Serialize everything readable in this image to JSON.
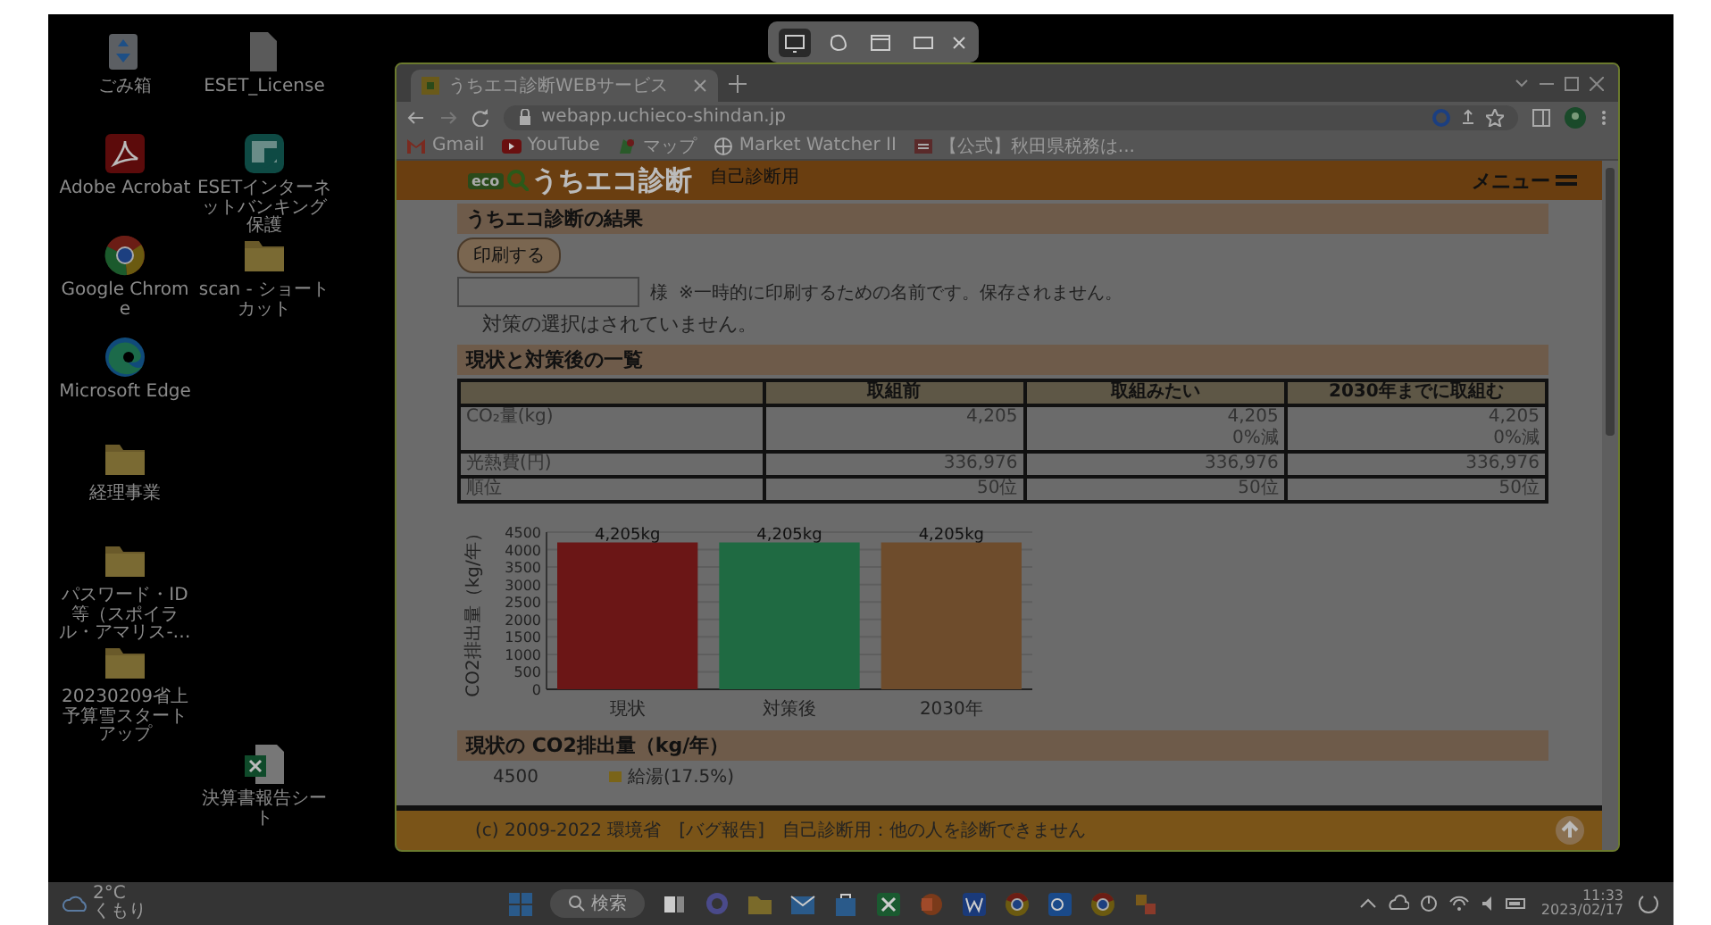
{
  "snip_toolbar": {
    "modes": [
      {
        "kind": "rectangle",
        "selected": true
      },
      {
        "kind": "freeform",
        "selected": false
      },
      {
        "kind": "window",
        "selected": false
      },
      {
        "kind": "fullscreen",
        "selected": false
      }
    ]
  },
  "desktop": {
    "icons": [
      {
        "label": "ごみ箱",
        "kind": "recycle"
      },
      {
        "label": "Adobe Acrobat",
        "kind": "pdf"
      },
      {
        "label": "Google Chrome",
        "kind": "chrome"
      },
      {
        "label": "Microsoft Edge",
        "kind": "edge"
      },
      {
        "label": "経理事業",
        "kind": "folder"
      },
      {
        "label": "パスワード・ID等（スポイラル・アマリス-…",
        "kind": "folder"
      },
      {
        "label": "20230209省上予算雪スタートアップ",
        "kind": "folder"
      },
      {
        "label": "ESET_License",
        "kind": "file"
      },
      {
        "label": "ESETインターネットバンキング保護",
        "kind": "shield"
      },
      {
        "label": "scan - ショートカット",
        "kind": "folder"
      },
      {
        "label": "決算書報告シート",
        "kind": "excel"
      }
    ]
  },
  "browser": {
    "tab": {
      "title": "うちエコ診断WEBサービス"
    },
    "address": "webapp.uchieco-shindan.jp",
    "bookmarks": [
      {
        "label": "Gmail",
        "kind": "gmail"
      },
      {
        "label": "YouTube",
        "kind": "youtube"
      },
      {
        "label": "マップ",
        "kind": "maps"
      },
      {
        "label": "Market Watcher II",
        "kind": "globe"
      },
      {
        "label": "【公式】秋田県税務は...",
        "kind": "site"
      }
    ],
    "page": {
      "header": {
        "logo_badge": "eco",
        "logo_text": "うちエコ診断",
        "mode": "自己診断用",
        "menu": "メニュー"
      },
      "result_title": "うちエコ診断の結果",
      "print_button": "印刷する",
      "name_field": {
        "suffix": "様",
        "note": "※一時的に印刷するための名前です。保存されません。"
      },
      "selection_message": "対策の選択はされていません。",
      "summary_title": "現状と対策後の一覧",
      "table": {
        "columns": [
          "",
          "取組前",
          "取組みたい",
          "2030年までに取組む"
        ],
        "rows": [
          {
            "cells": [
              [
                "CO₂量(kg)"
              ],
              [
                "4,205"
              ],
              [
                "4,205",
                "0%減"
              ],
              [
                "4,205",
                "0%減"
              ]
            ]
          },
          {
            "cells": [
              [
                "光熱費(円)"
              ],
              [
                "336,976"
              ],
              [
                "336,976"
              ],
              [
                "336,976"
              ]
            ]
          },
          {
            "cells": [
              [
                "順位"
              ],
              [
                "50位"
              ],
              [
                "50位"
              ],
              [
                "50位"
              ]
            ]
          }
        ]
      },
      "chart_data": {
        "type": "bar",
        "ylabel": "CO2排出量（kg/年）",
        "categories": [
          "現状",
          "対策後",
          "2030年"
        ],
        "values": [
          4205,
          4205,
          4205
        ],
        "grid": true,
        "ylim": [
          0,
          4500
        ],
        "yticks": [
          0,
          500,
          1000,
          1500,
          2000,
          2500,
          3000,
          3500,
          4000,
          4500
        ],
        "value_labels": [
          "4,205kg",
          "4,205kg",
          "4,205kg"
        ]
      },
      "breakdown_title": "現状の CO2排出量（kg/年）",
      "breakdown_tick": "4500",
      "breakdown_legend": [
        {
          "label": "給湯(17.5%)",
          "color": "#7a6418"
        }
      ],
      "footer": {
        "copyright": "(c) 2009-2022 環境省",
        "bug_link": "[バグ報告]",
        "notice": "自己診断用：他の人を診断できません"
      }
    }
  },
  "taskbar": {
    "weather": {
      "temp": "2°C",
      "condition": "くもり"
    },
    "search": "検索",
    "apps": [
      {
        "kind": "windows"
      },
      {
        "kind": "taskview"
      },
      {
        "kind": "chat"
      },
      {
        "kind": "explorer"
      },
      {
        "kind": "mail"
      },
      {
        "kind": "store"
      },
      {
        "kind": "excel"
      },
      {
        "kind": "powerpoint"
      },
      {
        "kind": "word"
      },
      {
        "kind": "chrome"
      },
      {
        "kind": "outlook"
      },
      {
        "kind": "chrome"
      },
      {
        "kind": "app"
      }
    ],
    "time": "11:33",
    "date": "2023/02/17"
  }
}
